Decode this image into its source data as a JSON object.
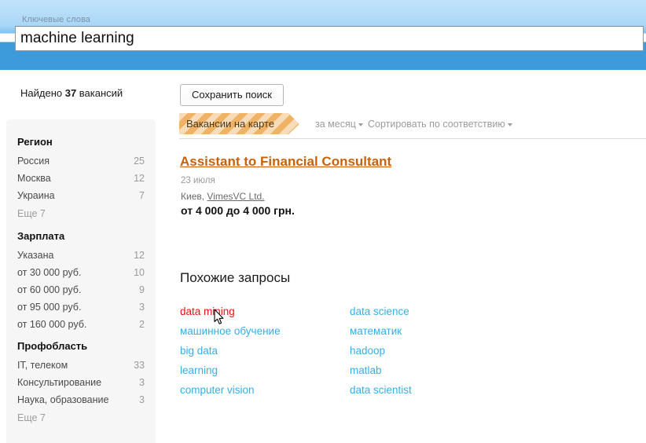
{
  "search": {
    "keywords_label": "Ключевые слова",
    "keywords_value": "machine learning"
  },
  "results": {
    "found_prefix": "Найдено ",
    "found_count": "37",
    "found_suffix": " вакансий",
    "save_search_label": "Сохранить поиск"
  },
  "toolbar": {
    "map_banner_label": "Вакансии на карте",
    "period_label": "за месяц",
    "sort_label": "Сортировать по соответствию"
  },
  "sidebar": {
    "groups": [
      {
        "title": "Регион",
        "items": [
          {
            "label": "Россия",
            "count": "25"
          },
          {
            "label": "Москва",
            "count": "12"
          },
          {
            "label": "Украина",
            "count": "7"
          }
        ],
        "more_label": "Еще 7"
      },
      {
        "title": "Зарплата",
        "items": [
          {
            "label": "Указана",
            "count": "12"
          },
          {
            "label": "от 30 000 руб.",
            "count": "10"
          },
          {
            "label": "от 60 000 руб.",
            "count": "9"
          },
          {
            "label": "от 95 000 руб.",
            "count": "3"
          },
          {
            "label": "от 160 000 руб.",
            "count": "2"
          }
        ],
        "more_label": ""
      },
      {
        "title": "Профобласть",
        "items": [
          {
            "label": "IT, телеком",
            "count": "33"
          },
          {
            "label": "Консультирование",
            "count": "3"
          },
          {
            "label": "Наука, образование",
            "count": "3"
          }
        ],
        "more_label": "Еще 7"
      }
    ]
  },
  "vacancy": {
    "title": "Assistant to Financial Consultant",
    "date": "23 июля",
    "city": "Киев, ",
    "company": "VimesVC Ltd.",
    "salary": "от 4 000 до 4 000 грн."
  },
  "similar": {
    "title": "Похожие запросы",
    "left": [
      {
        "label": "data mining",
        "state": "hovered"
      },
      {
        "label": "машинное обучение",
        "state": "normal"
      },
      {
        "label": "big data",
        "state": "normal"
      },
      {
        "label": "learning",
        "state": "normal"
      },
      {
        "label": "computer vision",
        "state": "normal"
      }
    ],
    "right": [
      {
        "label": "data science",
        "state": "normal"
      },
      {
        "label": "математик",
        "state": "normal"
      },
      {
        "label": "hadoop",
        "state": "normal"
      },
      {
        "label": "matlab",
        "state": "normal"
      },
      {
        "label": "data scientist",
        "state": "normal"
      }
    ]
  },
  "colors": {
    "header_blue": "#3d9bdc",
    "link_cyan": "#35aee8",
    "link_hover_red": "#ee1111",
    "title_orange": "#c8620a",
    "banner_orange": "#f0b264",
    "sidebar_bg": "#f6f6f6"
  }
}
